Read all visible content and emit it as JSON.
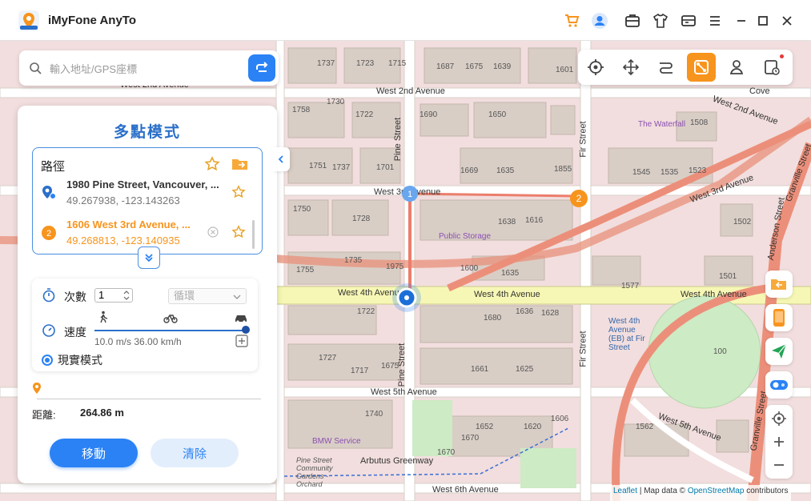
{
  "app": {
    "name": "iMyFone AnyTo"
  },
  "search": {
    "placeholder": "輸入地址/GPS座標"
  },
  "panel": {
    "title": "多點模式",
    "route_title": "路徑",
    "waypoints": [
      {
        "name": "1980 Pine Street, Vancouver, ...",
        "coords": "49.267938, -123.143263"
      },
      {
        "index": "2",
        "name": "1606 West 3rd Avenue, ...",
        "coords": "49.268813, -123.140935"
      }
    ],
    "count_label": "次數",
    "count_value": "1",
    "loop_option": "循環",
    "speed_label": "速度",
    "speed_text": "10.0 m/s   36.00 km/h",
    "real_mode_label": "現實模式",
    "distance_label": "距離:",
    "distance_value": "264.86 m",
    "move_button": "移動",
    "clear_button": "清除"
  },
  "map": {
    "streets": {
      "w2nd_a": "West 2nd Avenue",
      "w2nd_b": "West 2nd Avenue",
      "w2nd_c": "West 2nd Avenue",
      "w3rd_a": "West 3rd Avenue",
      "w3rd_b": "West 3rd Avenue",
      "w4th_a": "West 4th Avenue",
      "w4th_b": "West 4th Avenue",
      "w4th_c": "West 4th Avenue",
      "w5th_a": "West 5th Avenue",
      "w5th_b": "West 5th Avenue",
      "w6th": "West 6th Avenue",
      "pine_a": "Pine Street",
      "pine_b": "Pine Street",
      "fir_a": "Fir Street",
      "fir_b": "Fir Street",
      "anderson": "Anderson Street",
      "granville_a": "Granville Street",
      "granville_b": "Granville Street",
      "arbutus": "Arbutus Greenway"
    },
    "pois": {
      "public_storage": "Public Storage",
      "waterfall": "The Waterfall",
      "cove": "Cove",
      "bmw": "BMW Service",
      "bus_stop": "West 4th Avenue (EB) at Fir Street",
      "garden": "Pine Street Community Gardens - Orchard"
    },
    "buildings": [
      "1737",
      "1723",
      "1715",
      "1687",
      "1675",
      "1639",
      "1601",
      "1730",
      "1722",
      "1758",
      "1690",
      "1650",
      "1508",
      "1751",
      "1737",
      "1701",
      "1669",
      "1635",
      "1855",
      "1545",
      "1535",
      "1523",
      "1750",
      "1728",
      "1638",
      "1616",
      "1502",
      "1755",
      "1735",
      "1975",
      "1600",
      "1635",
      "1577",
      "1501",
      "1722",
      "1680",
      "1636",
      "1628",
      "1727",
      "1717",
      "1675",
      "1661",
      "1625",
      "1740",
      "1652",
      "1620",
      "1606",
      "1562",
      "1670",
      "1670",
      "100"
    ]
  },
  "attribution": {
    "leaflet": "Leaflet",
    "sep": "| Map data ©",
    "osm": "OpenStreetMap",
    "contrib": "contributors"
  }
}
